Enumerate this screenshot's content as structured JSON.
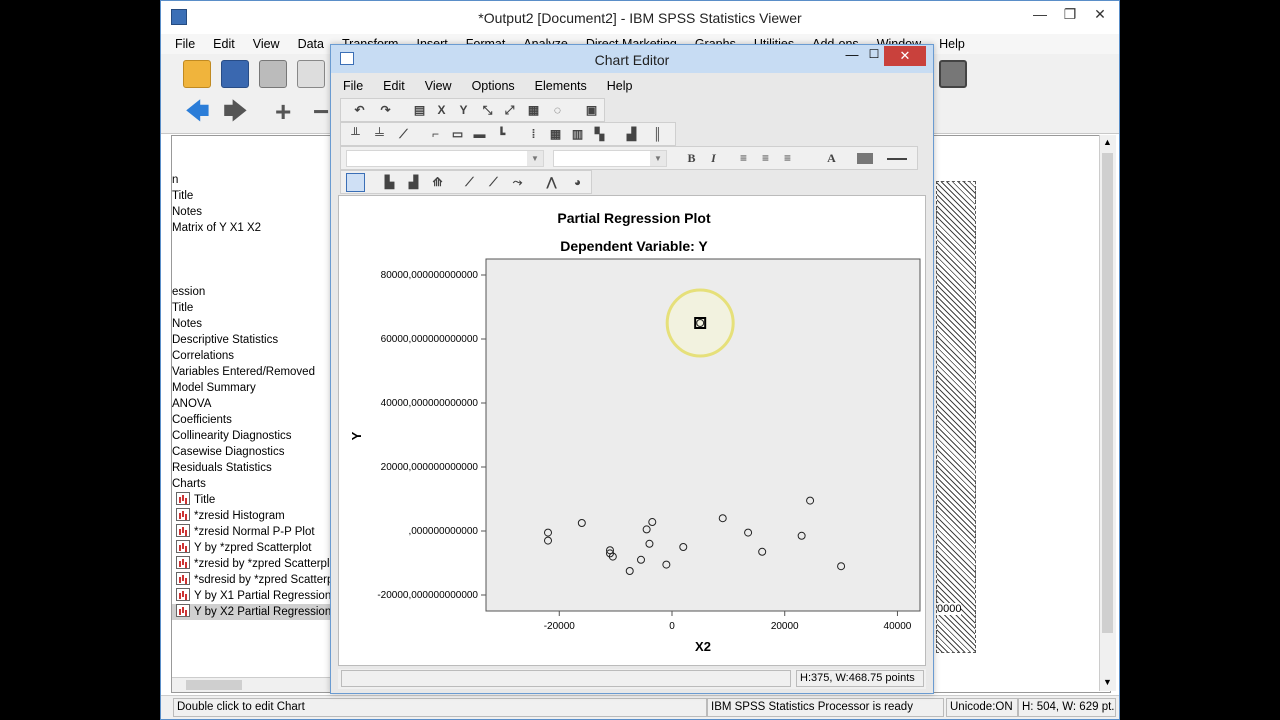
{
  "viewer": {
    "title": "*Output2 [Document2] - IBM SPSS Statistics Viewer",
    "menu": [
      "File",
      "Edit",
      "View",
      "Data",
      "Transform",
      "Insert",
      "Format",
      "Analyze",
      "Direct Marketing",
      "Graphs",
      "Utilities",
      "Add-ons",
      "Window",
      "Help"
    ],
    "outline": [
      {
        "label": "n",
        "icon": false
      },
      {
        "label": "Title",
        "icon": false
      },
      {
        "label": "Notes",
        "icon": false
      },
      {
        "label": "Matrix of Y X1 X2",
        "icon": false
      },
      {
        "label": "ession",
        "icon": false
      },
      {
        "label": "Title",
        "icon": false
      },
      {
        "label": "Notes",
        "icon": false
      },
      {
        "label": "Descriptive Statistics",
        "icon": false
      },
      {
        "label": "Correlations",
        "icon": false
      },
      {
        "label": "Variables Entered/Removed",
        "icon": false
      },
      {
        "label": "Model Summary",
        "icon": false
      },
      {
        "label": "ANOVA",
        "icon": false
      },
      {
        "label": "Coefficients",
        "icon": false
      },
      {
        "label": "Collinearity Diagnostics",
        "icon": false
      },
      {
        "label": "Casewise Diagnostics",
        "icon": false
      },
      {
        "label": "Residuals Statistics",
        "icon": false
      },
      {
        "label": "Charts",
        "icon": false
      },
      {
        "label": "Title",
        "icon": true
      },
      {
        "label": "*zresid Histogram",
        "icon": true
      },
      {
        "label": "*zresid Normal P-P Plot",
        "icon": true
      },
      {
        "label": "Y by *zpred Scatterplot",
        "icon": true
      },
      {
        "label": "*zresid by *zpred Scatterplot",
        "icon": true
      },
      {
        "label": "*sdresid by *zpred Scatterplot",
        "icon": true
      },
      {
        "label": "Y by X1 Partial Regression",
        "icon": true
      },
      {
        "label": "Y by X2 Partial Regression",
        "icon": true,
        "selected": true
      }
    ],
    "behind_tick": "0000",
    "status": {
      "hint": "Double click to edit Chart",
      "processor": "IBM SPSS Statistics Processor is ready",
      "unicode": "Unicode:ON",
      "size": "H: 504, W: 629 pt."
    }
  },
  "editor": {
    "title": "Chart Editor",
    "close": "✕",
    "minimize": "—",
    "maximize": "☐",
    "menu": [
      "File",
      "Edit",
      "View",
      "Options",
      "Elements",
      "Help"
    ],
    "status_size": "H:375, W:468.75 points",
    "format": {
      "bold": "B",
      "italic": "I",
      "text": "A"
    }
  },
  "chart_data": {
    "type": "scatter",
    "title": "Partial Regression Plot",
    "subtitle": "Dependent Variable: Y",
    "xlabel": "X2",
    "ylabel": "Y",
    "xlim": [
      -33000,
      44000
    ],
    "ylim": [
      -25000,
      85000
    ],
    "x_ticks": [
      -20000,
      0,
      20000,
      40000
    ],
    "x_tick_labels": [
      "-20000",
      "0",
      "20000",
      "40000"
    ],
    "y_ticks": [
      80000,
      60000,
      40000,
      20000,
      0,
      -20000
    ],
    "y_tick_labels": [
      "80000,000000000000",
      "60000,000000000000",
      "40000,000000000000",
      "20000,000000000000",
      ",000000000000",
      "-20000,000000000000"
    ],
    "points": [
      {
        "x": -22000,
        "y": -500
      },
      {
        "x": -22000,
        "y": -3000
      },
      {
        "x": -16000,
        "y": 2500
      },
      {
        "x": -11000,
        "y": -6000
      },
      {
        "x": -11000,
        "y": -7000
      },
      {
        "x": -10500,
        "y": -8000
      },
      {
        "x": -7500,
        "y": -12500
      },
      {
        "x": -5500,
        "y": -9000
      },
      {
        "x": -4500,
        "y": 500
      },
      {
        "x": -4000,
        "y": -4000
      },
      {
        "x": -3500,
        "y": 2800
      },
      {
        "x": -1000,
        "y": -10500
      },
      {
        "x": 2000,
        "y": -5000
      },
      {
        "x": 9000,
        "y": 4000
      },
      {
        "x": 13500,
        "y": -500
      },
      {
        "x": 16000,
        "y": -6500
      },
      {
        "x": 23000,
        "y": -1500
      },
      {
        "x": 24500,
        "y": 9500
      },
      {
        "x": 30000,
        "y": -11000
      },
      {
        "x": 5000,
        "y": 65000
      }
    ],
    "highlighted_point": {
      "x": 5000,
      "y": 65000
    },
    "plot_background": "#ececec"
  }
}
